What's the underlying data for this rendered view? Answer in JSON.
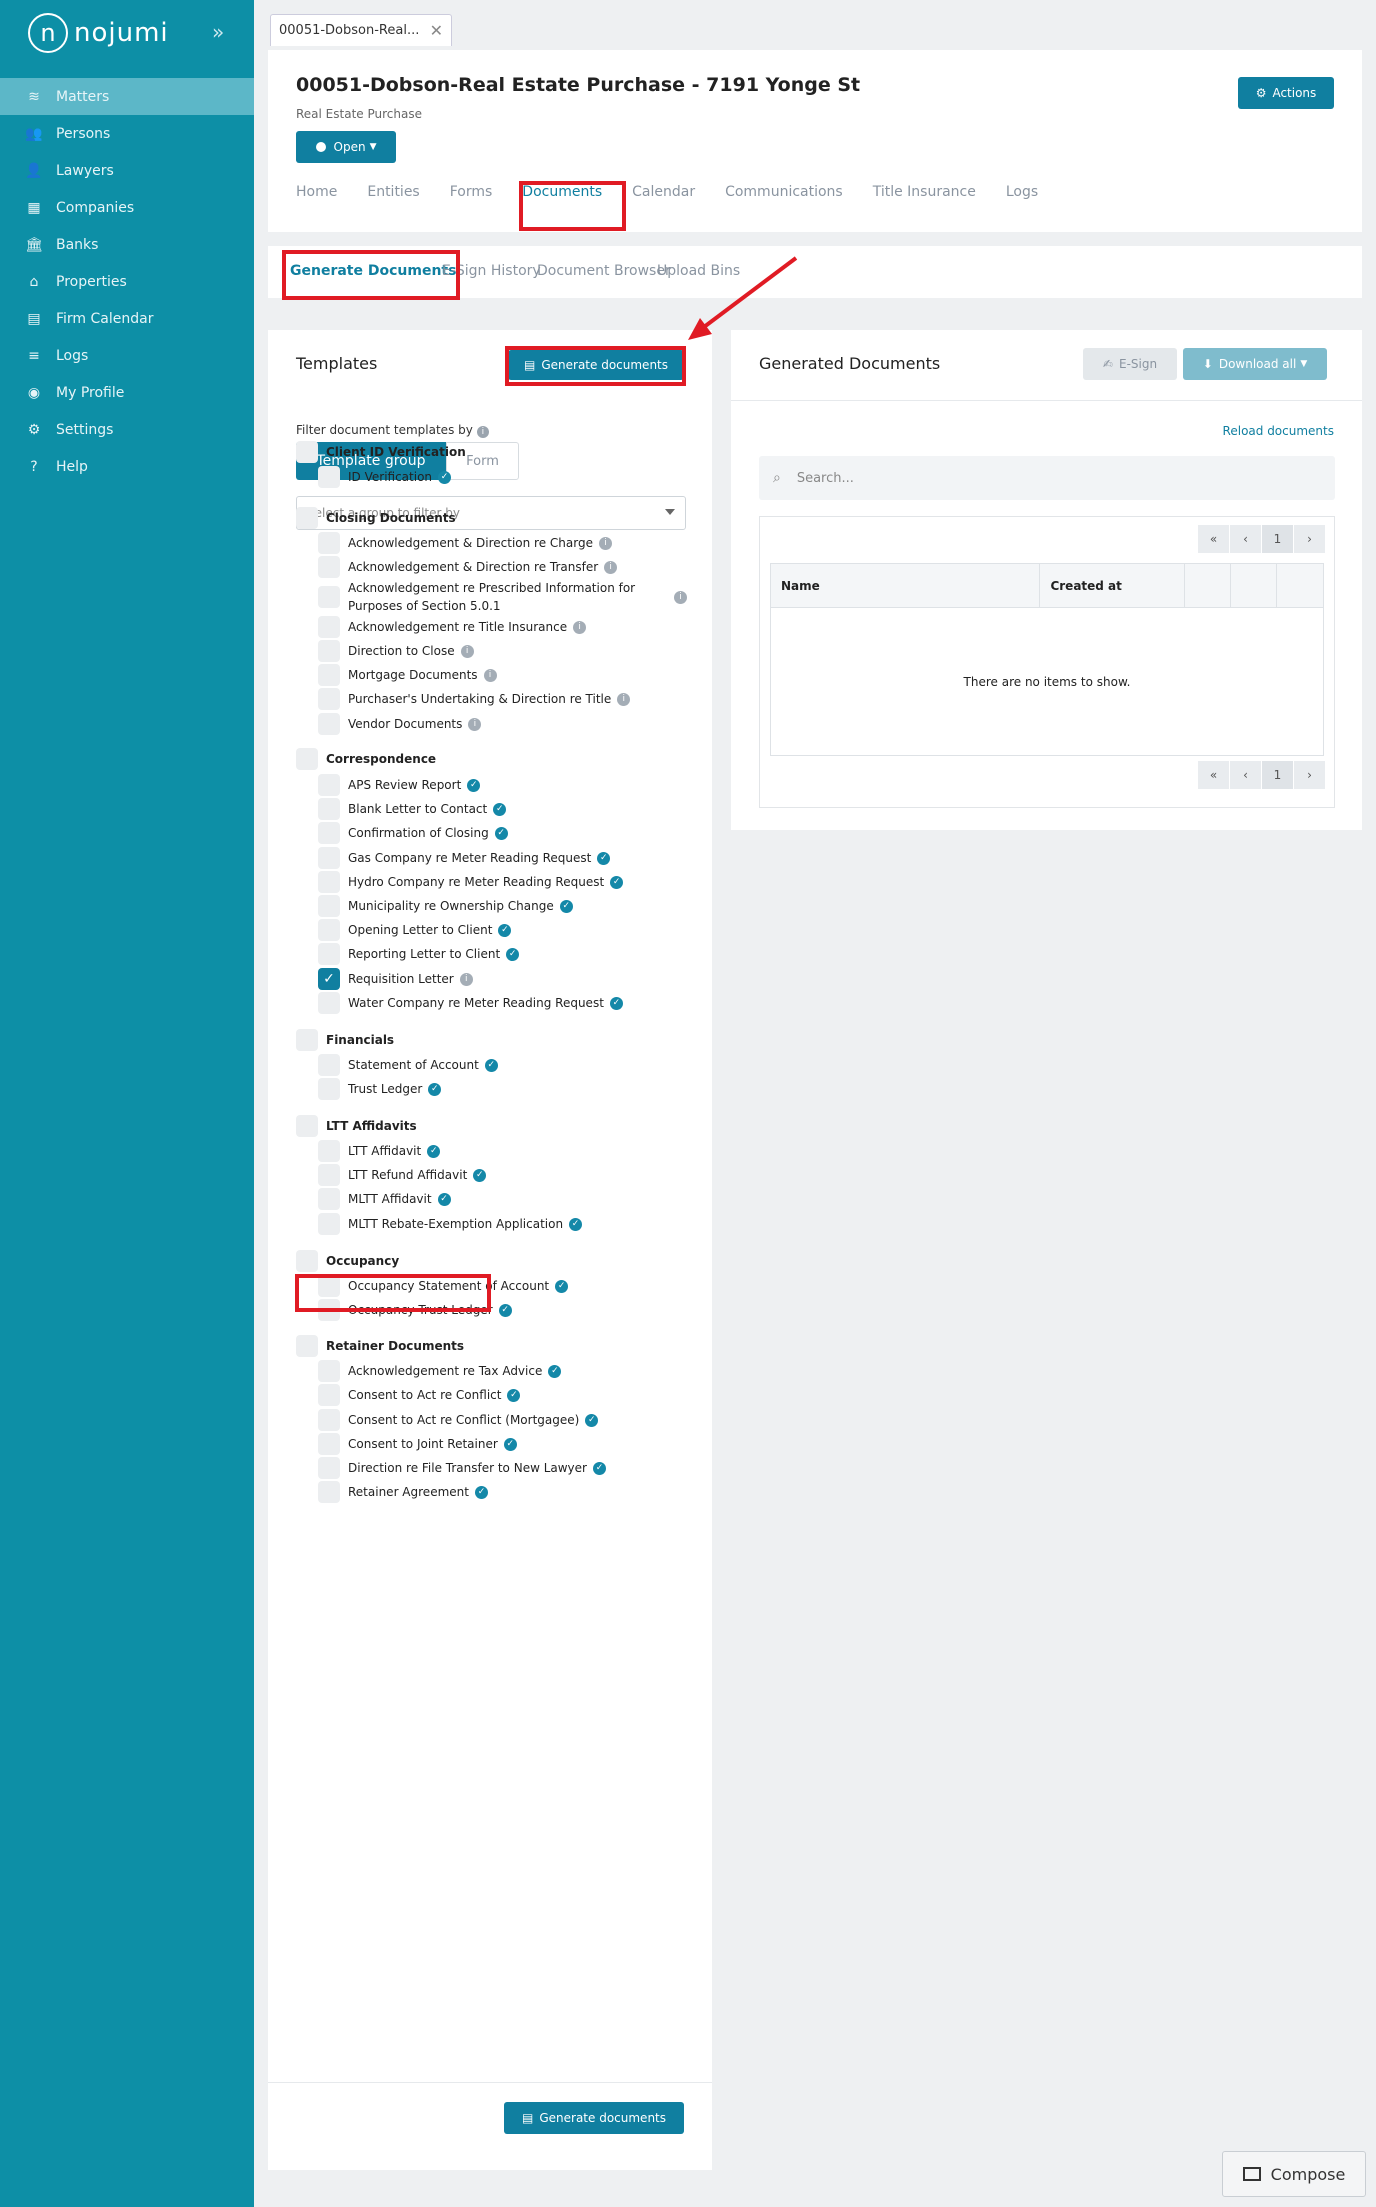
{
  "brand": {
    "name": "nojumi",
    "logo_letter": "n"
  },
  "sidebar": {
    "collapse_glyph": "»",
    "items": [
      {
        "label": "Matters",
        "icon": "layers-icon",
        "glyph": "≋",
        "active": true
      },
      {
        "label": "Persons",
        "icon": "users-icon",
        "glyph": "👥"
      },
      {
        "label": "Lawyers",
        "icon": "user-icon",
        "glyph": "👤"
      },
      {
        "label": "Companies",
        "icon": "building-icon",
        "glyph": "▦"
      },
      {
        "label": "Banks",
        "icon": "bank-icon",
        "glyph": "🏛"
      },
      {
        "label": "Properties",
        "icon": "home-icon",
        "glyph": "⌂"
      },
      {
        "label": "Firm Calendar",
        "icon": "calendar-icon",
        "glyph": "▤"
      },
      {
        "label": "Logs",
        "icon": "list-icon",
        "glyph": "≡"
      },
      {
        "label": "My Profile",
        "icon": "profile-icon",
        "glyph": "◉"
      },
      {
        "label": "Settings",
        "icon": "gear-icon",
        "glyph": "⚙"
      },
      {
        "label": "Help",
        "icon": "help-icon",
        "glyph": "?"
      }
    ]
  },
  "doc_tab": {
    "title": "00051-Dobson-Real...",
    "close": "✕"
  },
  "matter": {
    "title": "00051-Dobson-Real Estate Purchase - 7191 Yonge St",
    "subtitle": "Real Estate Purchase",
    "open_label": "Open",
    "actions_label": "Actions"
  },
  "main_tabs": [
    "Home",
    "Entities",
    "Forms",
    "Documents",
    "Calendar",
    "Communications",
    "Title Insurance",
    "Logs"
  ],
  "sub_tabs": [
    "Generate Documents",
    "E-Sign History",
    "Document Browser",
    "Upload Bins"
  ],
  "templates": {
    "title": "Templates",
    "generate_label": "Generate documents",
    "filter_label": "Filter document templates by",
    "segment": [
      "Template group",
      "Form"
    ],
    "select_placeholder": "Select a group to filter by",
    "groups": [
      {
        "name": "Client ID Verification",
        "items": [
          {
            "label": "ID Verification",
            "badge": "ok"
          }
        ]
      },
      {
        "name": "Closing Documents",
        "items": [
          {
            "label": "Acknowledgement & Direction re Charge",
            "badge": "info"
          },
          {
            "label": "Acknowledgement & Direction re Transfer",
            "badge": "info"
          },
          {
            "label": "Acknowledgement re Prescribed Information for Purposes of Section 5.0.1",
            "badge": "info"
          },
          {
            "label": "Acknowledgement re Title Insurance",
            "badge": "info"
          },
          {
            "label": "Direction to Close",
            "badge": "info"
          },
          {
            "label": "Mortgage Documents",
            "badge": "info"
          },
          {
            "label": "Purchaser's Undertaking & Direction re Title",
            "badge": "info"
          },
          {
            "label": "Vendor Documents",
            "badge": "info"
          }
        ]
      },
      {
        "name": "Correspondence",
        "items": [
          {
            "label": "APS Review Report",
            "badge": "ok"
          },
          {
            "label": "Blank Letter to Contact",
            "badge": "ok"
          },
          {
            "label": "Confirmation of Closing",
            "badge": "ok"
          },
          {
            "label": "Gas Company re Meter Reading Request",
            "badge": "ok"
          },
          {
            "label": "Hydro Company re Meter Reading Request",
            "badge": "ok"
          },
          {
            "label": "Municipality re Ownership Change",
            "badge": "ok"
          },
          {
            "label": "Opening Letter to Client",
            "badge": "ok"
          },
          {
            "label": "Reporting Letter to Client",
            "badge": "ok"
          },
          {
            "label": "Requisition Letter",
            "badge": "info",
            "checked": true
          },
          {
            "label": "Water Company re Meter Reading Request",
            "badge": "ok"
          }
        ]
      },
      {
        "name": "Financials",
        "items": [
          {
            "label": "Statement of Account",
            "badge": "ok"
          },
          {
            "label": "Trust Ledger",
            "badge": "ok"
          }
        ]
      },
      {
        "name": "LTT Affidavits",
        "items": [
          {
            "label": "LTT Affidavit",
            "badge": "ok"
          },
          {
            "label": "LTT Refund Affidavit",
            "badge": "ok"
          },
          {
            "label": "MLTT Affidavit",
            "badge": "ok"
          },
          {
            "label": "MLTT Rebate-Exemption Application",
            "badge": "ok"
          }
        ]
      },
      {
        "name": "Occupancy",
        "items": [
          {
            "label": "Occupancy Statement of Account",
            "badge": "ok"
          },
          {
            "label": "Occupancy Trust Ledger",
            "badge": "ok"
          }
        ]
      },
      {
        "name": "Retainer Documents",
        "items": [
          {
            "label": "Acknowledgement re Tax Advice",
            "badge": "ok"
          },
          {
            "label": "Consent to Act re Conflict",
            "badge": "ok"
          },
          {
            "label": "Consent to Act re Conflict (Mortgagee)",
            "badge": "ok"
          },
          {
            "label": "Consent to Joint Retainer",
            "badge": "ok"
          },
          {
            "label": "Direction re File Transfer to New Lawyer",
            "badge": "ok"
          },
          {
            "label": "Retainer Agreement",
            "badge": "ok"
          }
        ]
      }
    ]
  },
  "generated": {
    "title": "Generated Documents",
    "esign_label": "E-Sign",
    "download_label": "Download all",
    "reload_label": "Reload documents",
    "search_placeholder": "Search...",
    "columns": [
      "Name",
      "Created at",
      "",
      "",
      ""
    ],
    "empty_text": "There are no items to show.",
    "pager": [
      "«",
      "‹",
      "1",
      "›"
    ]
  },
  "compose_label": "Compose",
  "colors": {
    "sidebar": "#0d8fa6",
    "primary": "#107fa0",
    "annotation": "#e01b24"
  }
}
